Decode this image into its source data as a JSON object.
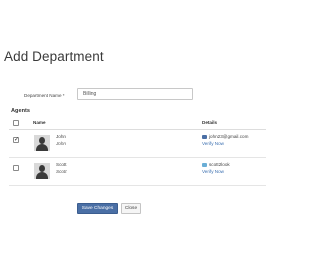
{
  "page": {
    "title": "Add Department"
  },
  "form": {
    "department_name_label": "Department Name *",
    "department_name_value": "Billing"
  },
  "agents": {
    "section_title": "Agents",
    "columns": {
      "name": "Name",
      "details": "Details"
    },
    "rows": [
      {
        "checked": true,
        "name": "John",
        "subname": "John",
        "email": "john23@gmail.com",
        "email_icon_color": "#4a6fa5",
        "verify_label": "Verify Now"
      },
      {
        "checked": false,
        "name": "Scott",
        "subname": "Scott",
        "email": "scott2look",
        "email_icon_color": "#6aaed6",
        "verify_label": "Verify Now"
      }
    ]
  },
  "actions": {
    "save_label": "Save Changes",
    "close_label": "Close"
  },
  "colors": {
    "primary_button": "#4a6fa5",
    "link": "#3a6fb0"
  }
}
